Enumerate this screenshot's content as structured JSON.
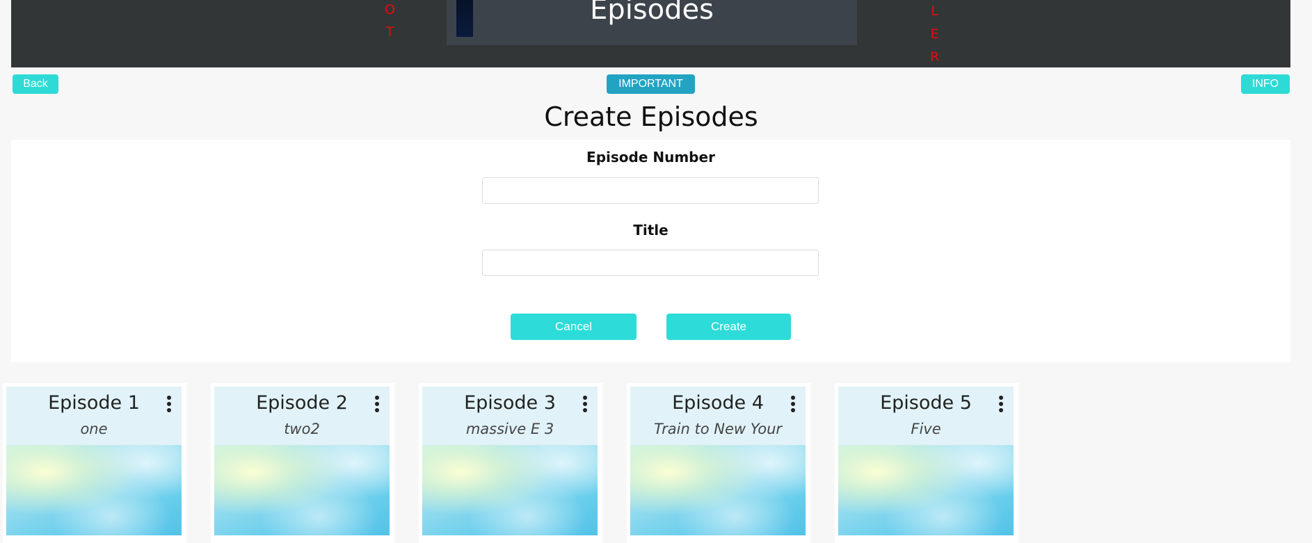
{
  "header": {
    "title": "Episodes",
    "left_letters": [
      "O",
      "T"
    ],
    "right_letters": [
      "L",
      "E",
      "R"
    ]
  },
  "nav": {
    "back_label": "Back",
    "important_label": "IMPORTANT",
    "info_label": "INFO"
  },
  "page_title": "Create Episodes",
  "form": {
    "episode_number_label": "Episode Number",
    "episode_number_value": "",
    "episode_number_placeholder": "",
    "title_label": "Title",
    "title_value": "",
    "title_placeholder": "",
    "cancel_label": "Cancel",
    "create_label": "Create"
  },
  "episodes": [
    {
      "title": "Episode 1",
      "subtitle": "one"
    },
    {
      "title": "Episode 2",
      "subtitle": "two2"
    },
    {
      "title": "Episode 3",
      "subtitle": "massive E 3"
    },
    {
      "title": "Episode 4",
      "subtitle": "Train to New Your"
    },
    {
      "title": "Episode 5",
      "subtitle": "Five"
    }
  ],
  "icons": {
    "card_menu": "kebab-menu-icon"
  },
  "colors": {
    "accent": "#2edad6",
    "important": "#23a3c2",
    "header_bg": "#333637",
    "letters": "#e40d0d",
    "card_head": "#e1f3f8"
  }
}
